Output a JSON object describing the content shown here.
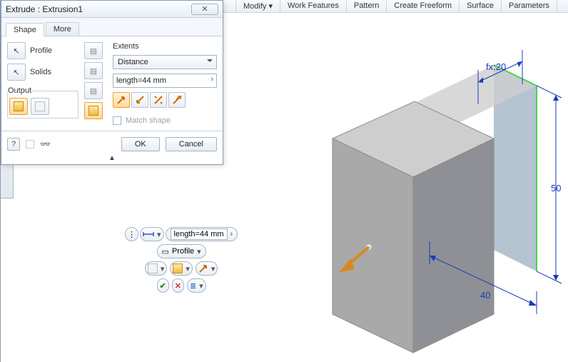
{
  "menu": {
    "modify": "Modify ▾",
    "work_features": "Work Features",
    "pattern": "Pattern",
    "create_freeform": "Create Freeform",
    "surface": "Surface",
    "parameters": "Parameters"
  },
  "dialog": {
    "title": "Extrude : Extrusion1",
    "tabs": {
      "shape": "Shape",
      "more": "More"
    },
    "profile_label": "Profile",
    "solids_label": "Solids",
    "output_label": "Output",
    "extents_label": "Extents",
    "extents_mode": "Distance",
    "distance_value": "length=44 mm",
    "match_shape_label": "Match shape",
    "ok": "OK",
    "cancel": "Cancel",
    "help": "?"
  },
  "hud": {
    "length_value": "length=44 mm",
    "profile_label": "Profile"
  },
  "dims": {
    "fx20": "fx:20",
    "d50": "50",
    "d40": "40"
  }
}
